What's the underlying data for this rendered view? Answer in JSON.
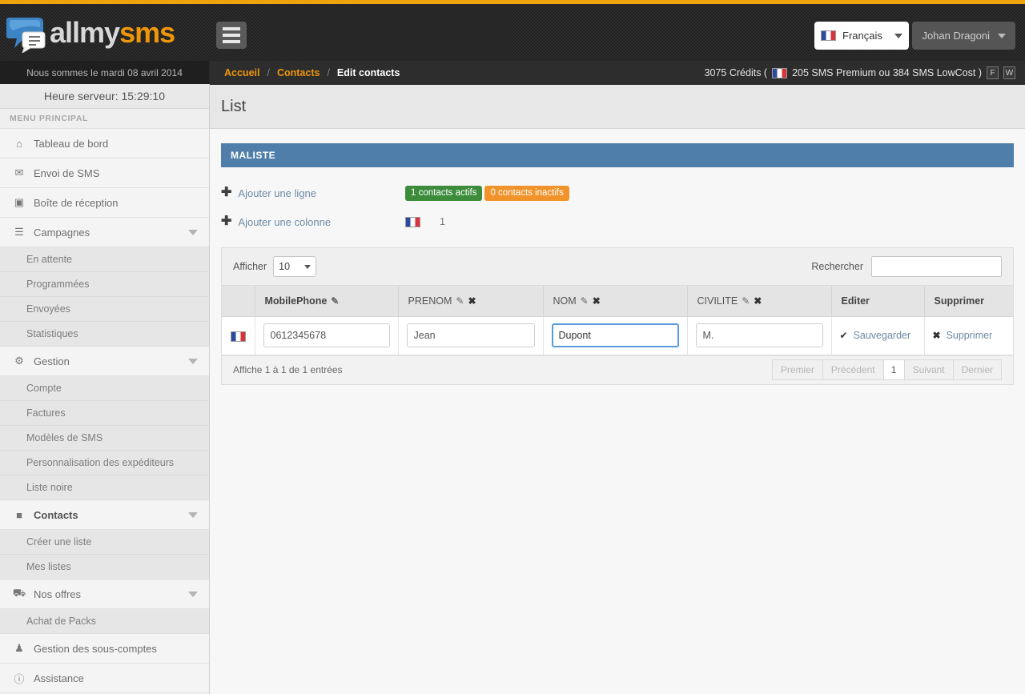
{
  "brand": {
    "name_a": "allmy",
    "name_b": "sms",
    "logo_icon": "speech-bubble-logo"
  },
  "header": {
    "hamburger_icon": "hamburger-menu-icon",
    "language": {
      "label": "Français",
      "flag_icon": "france-flag-icon",
      "caret_icon": "chevron-down-icon"
    },
    "user": {
      "name": "Johan Dragoni",
      "caret_icon": "caret-down-icon"
    }
  },
  "breadcrumb": {
    "home": "Accueil",
    "sep": "/",
    "section": "Contacts",
    "current": "Edit contacts"
  },
  "credits": {
    "text_before": "3075 Crédits (",
    "flag_icon": "france-flag-icon",
    "text_after": "205 SMS Premium ou 384 SMS LowCost )",
    "buttons": [
      "F",
      "W"
    ]
  },
  "sidebar": {
    "date": "Nous sommes le mardi 08 avril 2014",
    "server_time": "Heure serveur: 15:29:10",
    "menu_title": "MENU PRINCIPAL",
    "items": [
      {
        "label": "Tableau de bord",
        "icon": "home-icon",
        "type": "nav",
        "caret": false
      },
      {
        "label": "Envoi de SMS",
        "icon": "envelope-icon",
        "type": "nav",
        "caret": false
      },
      {
        "label": "Boîte de réception",
        "icon": "inbox-icon",
        "type": "nav",
        "caret": false
      },
      {
        "label": "Campagnes",
        "icon": "list-icon",
        "type": "nav",
        "caret": true
      },
      {
        "label": "En attente",
        "type": "sub"
      },
      {
        "label": "Programmées",
        "type": "sub"
      },
      {
        "label": "Envoyées",
        "type": "sub"
      },
      {
        "label": "Statistiques",
        "type": "sub"
      },
      {
        "label": "Gestion",
        "icon": "gear-icon",
        "type": "nav",
        "caret": true
      },
      {
        "label": "Compte",
        "type": "sub"
      },
      {
        "label": "Factures",
        "type": "sub"
      },
      {
        "label": "Modèles de SMS",
        "type": "sub"
      },
      {
        "label": "Personnalisation des expéditeurs",
        "type": "sub"
      },
      {
        "label": "Liste noire",
        "type": "sub"
      },
      {
        "label": "Contacts",
        "icon": "book-icon",
        "type": "nav",
        "caret": true,
        "active": true
      },
      {
        "label": "Créer une liste",
        "type": "sub"
      },
      {
        "label": "Mes listes",
        "type": "sub"
      },
      {
        "label": "Nos offres",
        "icon": "cart-icon",
        "type": "nav",
        "caret": true
      },
      {
        "label": "Achat de Packs",
        "type": "sub"
      },
      {
        "label": "Gestion des sous-comptes",
        "icon": "user-icon",
        "type": "nav",
        "caret": false
      },
      {
        "label": "Assistance",
        "icon": "info-icon",
        "type": "nav",
        "caret": false
      }
    ]
  },
  "page": {
    "title": "List"
  },
  "panel": {
    "title": "MALISTE",
    "color": "#507eaa"
  },
  "actions": {
    "add_row": {
      "label": "Ajouter une ligne",
      "icon": "plus-icon"
    },
    "add_column": {
      "label": "Ajouter une colonne",
      "icon": "plus-icon"
    },
    "badge_active": {
      "label": "1 contacts actifs",
      "color": "#3c8c3c"
    },
    "badge_inactive": {
      "label": "0 contacts inactifs",
      "color": "#f0932b"
    },
    "country_flag_icon": "france-flag-icon",
    "country_count": "1"
  },
  "table": {
    "length_label": "Afficher",
    "length_value": "10",
    "search_label": "Rechercher",
    "search_value": "",
    "search_placeholder": "",
    "columns": [
      {
        "label": "",
        "editable": false,
        "removable": false,
        "bold": false
      },
      {
        "label": "MobilePhone",
        "editable": true,
        "removable": false,
        "bold": true
      },
      {
        "label": "PRENOM",
        "editable": true,
        "removable": true,
        "bold": false
      },
      {
        "label": "NOM",
        "editable": true,
        "removable": true,
        "bold": false
      },
      {
        "label": "CIVILITE",
        "editable": true,
        "removable": true,
        "bold": false
      },
      {
        "label": "Editer",
        "editable": false,
        "removable": false,
        "bold": true
      },
      {
        "label": "Supprimer",
        "editable": false,
        "removable": false,
        "bold": true
      }
    ],
    "row": {
      "flag_icon": "france-flag-icon",
      "mobilephone": "0612345678",
      "prenom": "Jean",
      "nom": "Dupont",
      "civilite": "M.",
      "save_label": "Sauvegarder",
      "save_icon": "check-icon",
      "delete_label": "Supprimer",
      "delete_icon": "cross-icon"
    },
    "info": "Affiche 1 à 1 de 1 entrées",
    "pager": [
      {
        "label": "Premier",
        "current": false
      },
      {
        "label": "Précédent",
        "current": false
      },
      {
        "label": "1",
        "current": true
      },
      {
        "label": "Suivant",
        "current": false
      },
      {
        "label": "Dernier",
        "current": false
      }
    ]
  }
}
